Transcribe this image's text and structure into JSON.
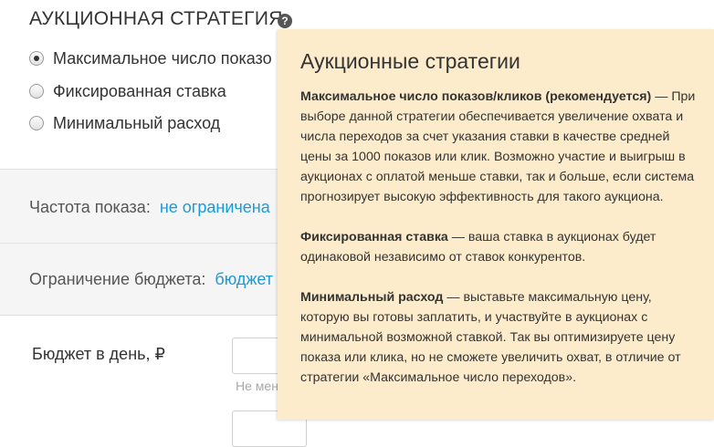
{
  "strategy": {
    "title": "АУКЦИОННАЯ СТРАТЕГИЯ",
    "help_icon": "question-icon",
    "options": [
      {
        "label": "Максимальное число показо",
        "checked": true
      },
      {
        "label": "Фиксированная ставка",
        "checked": false
      },
      {
        "label": "Минимальный расход",
        "checked": false
      }
    ]
  },
  "frequency": {
    "label": "Частота показа:",
    "value": "не ограничена"
  },
  "budget_limit": {
    "label": "Ограничение бюджета:",
    "value": "бюджет"
  },
  "daily_budget": {
    "label": "Бюджет в день, ₽",
    "hint": "Не мен"
  },
  "tooltip": {
    "title": "Аукционные стратегии",
    "items": [
      {
        "term": "Максимальное число показов/кликов (рекомендуется)",
        "text": " — При выборе данной стратегии обеспечивается увеличение охвата и числа переходов за счет указания ставки в качестве средней цены за 1000 показов или клик. Возможно участие и выигрыш в аукционах с оплатой меньше ставки, так и больше, если система прогнозирует высокую эффективность для такого аукциона."
      },
      {
        "term": "Фиксированная ставка",
        "text": " — ваша ставка в аукционах будет одинаковой независимо от ставок конкурентов."
      },
      {
        "term": "Минимальный расход",
        "text": " — выставьте максимальную цену, которую вы готовы заплатить, и участвуйте в аукционах с минимальной возможной ставкой. Так вы оптимизируете цену показа или клика, но не сможете увеличить охват,  в отличие от стратегии «Максимальное число переходов»."
      }
    ]
  },
  "colors": {
    "link": "#1a9bd7",
    "tooltip_bg": "#fdeccc",
    "band_bg": "#f5f5f5"
  }
}
